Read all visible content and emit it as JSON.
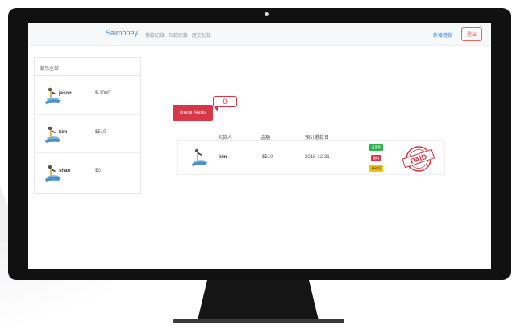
{
  "nav": {
    "brand": "Salmoney",
    "links": [
      "借款紀錄",
      "欠款紀錄",
      "歷史紀錄"
    ],
    "new_loan": "新增借款",
    "logout": "登出"
  },
  "sidebar": {
    "show_all": "顯示全部",
    "people": [
      {
        "name": "jason",
        "amount": "$-1000"
      },
      {
        "name": "kim",
        "amount": "$510"
      },
      {
        "name": "shan",
        "amount": "$0"
      }
    ]
  },
  "alerts": {
    "button_label": "check Alerts",
    "count": "0"
  },
  "table": {
    "headers": [
      "欠款人",
      "金額",
      "預計還款日"
    ],
    "row": {
      "name": "kim",
      "amount": "$510",
      "due_date": "2018-12-31",
      "badges": [
        "已還款",
        "刪除",
        "待確認"
      ],
      "stamp": "PAID"
    }
  },
  "colors": {
    "accent": "#3c89d0",
    "danger": "#d93646",
    "success": "#2fb14f",
    "warning": "#f2c10f"
  }
}
